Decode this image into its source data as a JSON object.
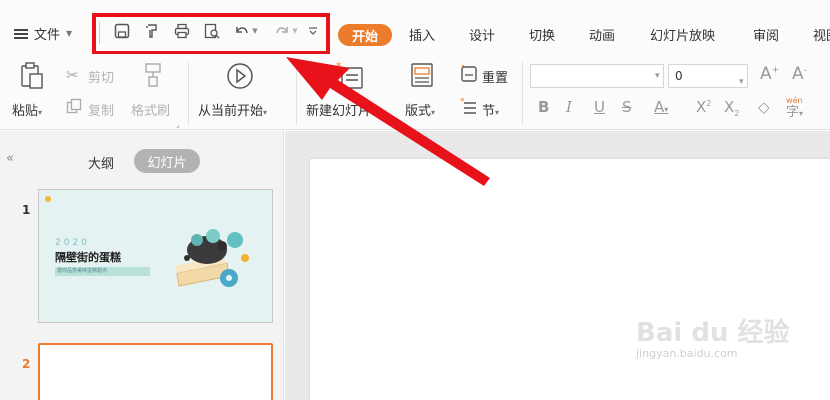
{
  "menu": {
    "file_label": "文件"
  },
  "tabs": [
    {
      "label": "开始",
      "active": true
    },
    {
      "label": "插入"
    },
    {
      "label": "设计"
    },
    {
      "label": "切换"
    },
    {
      "label": "动画"
    },
    {
      "label": "幻灯片放映"
    },
    {
      "label": "审阅"
    },
    {
      "label": "视图"
    }
  ],
  "quick_access": [
    "save-icon",
    "format-painter-icon",
    "print-icon",
    "print-preview-icon",
    "undo-icon",
    "redo-icon",
    "customize-icon"
  ],
  "ribbon": {
    "paste": "粘贴",
    "cut": "剪切",
    "copy": "复制",
    "format_painter": "格式刷",
    "from_current": "从当前开始",
    "new_slide": "新建幻灯片",
    "layout": "版式",
    "reset": "重置",
    "section": "节",
    "font_name": "",
    "font_size": "0"
  },
  "left_pane": {
    "outline_tab": "大纲",
    "slides_tab": "幻灯片",
    "slide1_num": "1",
    "slide2_num": "2",
    "slide1_year": "2020",
    "slide1_title": "隔壁街的蛋糕",
    "slide1_subtitle": "邀你品尝美味蛋糕甜点"
  },
  "watermark": {
    "brand": "Bai du 经验",
    "url": "jingyan.baidu.com"
  },
  "colors": {
    "accent": "#ec7b2c",
    "highlight_red": "#e8121a",
    "slide_thumb_bg": "#e4f3f1"
  }
}
